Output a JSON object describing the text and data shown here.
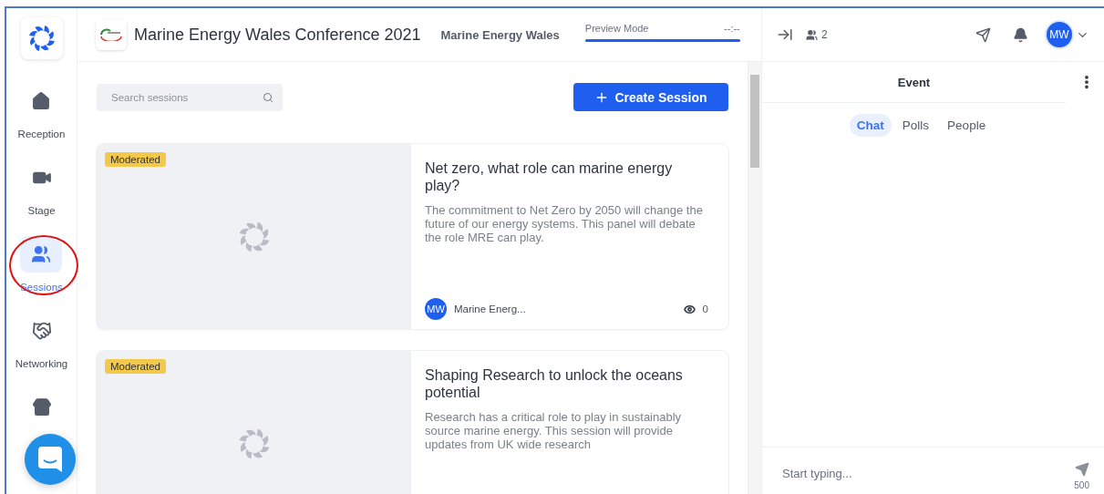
{
  "sidebar": {
    "items": [
      {
        "label": "Reception",
        "selected": false
      },
      {
        "label": "Stage",
        "selected": false
      },
      {
        "label": "Sessions",
        "selected": true
      },
      {
        "label": "Networking",
        "selected": false
      },
      {
        "selected": false
      }
    ]
  },
  "header": {
    "event_title": "Marine Energy Wales Conference 2021",
    "organizer": "Marine Energy Wales",
    "preview_label": "Preview Mode",
    "timer": "--:--",
    "preview_progress": {
      "level": 1
    }
  },
  "search": {
    "placeholder": "Search sessions"
  },
  "create_button": "Create Session",
  "sessions": [
    {
      "badge": "Moderated",
      "title": "Net zero, what role can marine energy play?",
      "description": "The commitment to Net Zero by 2050 will change the future of our energy systems. This panel will debate the role MRE can play.",
      "host_initials": "MW",
      "host_name": "Marine Energ...",
      "views": "0"
    },
    {
      "badge": "Moderated",
      "title": "Shaping Research to unlock the oceans potential",
      "description": "Research has a critical role to play in sustainably source marine energy. This session will provide updates from UK wide research"
    }
  ],
  "topbar": {
    "attendee_count": "2",
    "avatar_initials": "MW"
  },
  "chat_panel": {
    "title": "Event",
    "tabs": [
      {
        "label": "Chat",
        "selected": true
      },
      {
        "label": "Polls",
        "selected": false
      },
      {
        "label": "People",
        "selected": false
      }
    ],
    "placeholder": "Start typing...",
    "char_count": "500"
  }
}
